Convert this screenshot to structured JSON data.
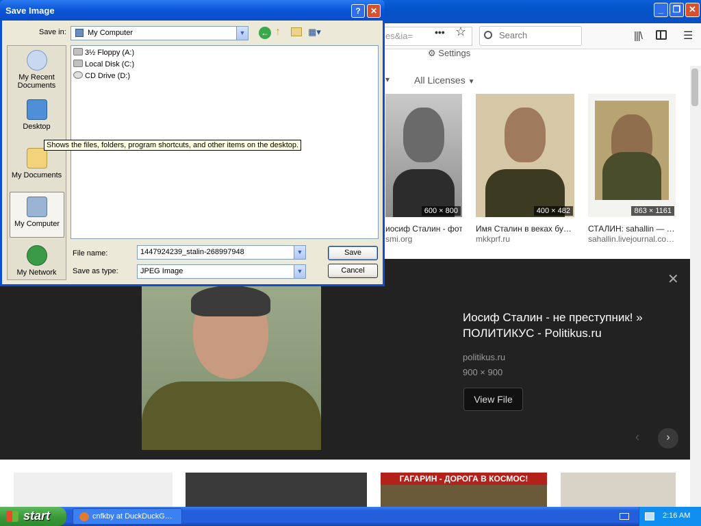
{
  "browser": {
    "url_fragment": "es&ia=",
    "url_more": "•••",
    "search_placeholder": "Search",
    "settings_label": "Settings",
    "filter_licenses": "All Licenses",
    "thumbs": [
      {
        "size": "600 × 800",
        "title": "иосиф Сталин - фот…",
        "source": "smi.org"
      },
      {
        "size": "400 × 482",
        "title": "Имя Сталин в веках бу…",
        "source": "mkkprf.ru"
      },
      {
        "size": "863 × 1161",
        "title": "СТАЛИН: sahallin — …",
        "source": "sahallin.livejournal.co…"
      }
    ],
    "detail": {
      "title": "Иосиф Сталин - не преступник! » ПОЛИТИКУС - Politikus.ru",
      "source": "politikus.ru",
      "dims": "900 × 900",
      "view_file": "View File",
      "close": "✕",
      "prev": "‹",
      "next": "›"
    },
    "bottom_banner": "ГАГАРИН - ДОРОГА В КОСМОС!"
  },
  "dialog": {
    "title": "Save Image",
    "help": "?",
    "close": "✕",
    "save_in_label": "Save in:",
    "save_in_value": "My Computer",
    "places": [
      {
        "label": "My Recent Documents"
      },
      {
        "label": "Desktop"
      },
      {
        "label": "My Documents"
      },
      {
        "label": "My Computer"
      },
      {
        "label": "My Network"
      }
    ],
    "files": [
      {
        "name": "3½ Floppy (A:)"
      },
      {
        "name": "Local Disk (C:)"
      },
      {
        "name": "CD Drive (D:)"
      }
    ],
    "tooltip": "Shows the files, folders, program shortcuts, and other items on the desktop.",
    "filename_label": "File name:",
    "filename_value": "1447924239_stalin-268997948",
    "savetype_label": "Save as type:",
    "savetype_value": "JPEG Image",
    "save_button": "Save",
    "cancel_button": "Cancel"
  },
  "taskbar": {
    "start_label": "start",
    "task_label": "cnfkby at DuckDuckG…",
    "time": "2:16 AM"
  }
}
